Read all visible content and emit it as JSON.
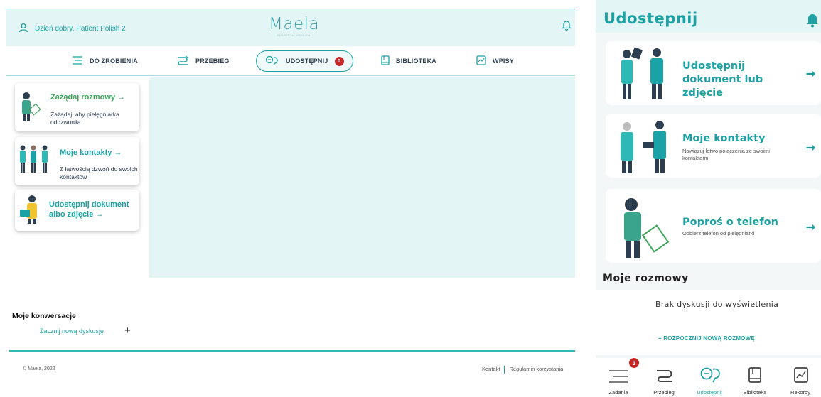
{
  "desktop": {
    "greeting": "Dzień dobry, Patient Polish 2",
    "logo": {
      "name": "Maela",
      "tagline": "ZA KAŻDYM KROKIEM"
    },
    "nav": [
      {
        "label": "DO ZROBIENIA",
        "icon": "list-icon"
      },
      {
        "label": "PRZEBIEG",
        "icon": "route-icon"
      },
      {
        "label": "UDOSTĘPNIJ",
        "icon": "share-icon",
        "badge": "0",
        "active": true
      },
      {
        "label": "BIBLIOTEKA",
        "icon": "book-icon"
      },
      {
        "label": "WPISY",
        "icon": "journal-icon"
      }
    ],
    "cards": [
      {
        "title": "Zażądaj rozmowy →",
        "desc": "Zażądaj, aby pielęgniarka oddzwoniła",
        "color": "#3aa55a"
      },
      {
        "title": "Moje kontakty →",
        "desc": "Z łatwością dzwoń do swoich kontaktów",
        "color": "#1aa2a6"
      },
      {
        "title": "Udostępnij dokument albo zdjęcie →",
        "desc": "",
        "color": "#1aa2a6"
      }
    ],
    "conversations": {
      "title": "Moje konwersacje",
      "start": "Zacznij nową dyskusję",
      "plus": "+"
    },
    "footer": {
      "copyright": "© Maela, 2022",
      "links": [
        "Kontakt",
        "Regulamin korzystania"
      ]
    }
  },
  "mobile": {
    "title": "Udostępnij",
    "cards": [
      {
        "title": "Udostępnij dokument lub zdjęcie",
        "desc": ""
      },
      {
        "title": "Moje kontakty",
        "desc": "Nawiązuj łatwo połączenia ze swoimi kontaktami"
      },
      {
        "title": "Poproś o telefon",
        "desc": "Odbierz telefon od pielęgniarki"
      }
    ],
    "section_title": "Moje rozmowy",
    "empty": "Brak dyskusji do wyświetlenia",
    "new_conversation": "+ ROZPOCZNIJ NOWĄ ROZMOWĘ",
    "tabs": [
      {
        "label": "Zadania",
        "badge": "3"
      },
      {
        "label": "Przebieg"
      },
      {
        "label": "Udostępnij",
        "active": true
      },
      {
        "label": "Biblioteka"
      },
      {
        "label": "Rekordy"
      }
    ]
  },
  "colors": {
    "accent": "#1aa2a6",
    "light_bg": "#e3f6f5",
    "badge": "#c62828",
    "green": "#3aa55a"
  }
}
